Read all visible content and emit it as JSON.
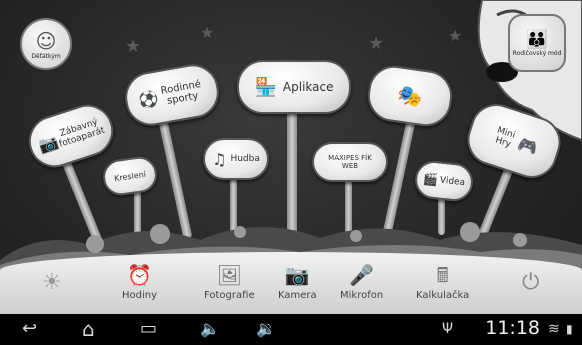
{
  "top": {
    "child_profile_label": "Děťátkým",
    "parent_mode_label": "Rodičovský mód"
  },
  "signs": {
    "fun_camera": "Zábavný fotoaparát",
    "family_sports": "Rodinné sporty",
    "apps": "Aplikace",
    "drawing": "Kreslení",
    "music": "Hudba",
    "web": "MAXIPES FÍK WEB",
    "video": "Videa",
    "mini_games": "Mini Hry"
  },
  "dock": {
    "hodiny": "Hodiny",
    "fotografie": "Fotografie",
    "kamera": "Kamera",
    "mikrofon": "Mikrofon",
    "kalkulacka": "Kalkulačka"
  },
  "status": {
    "time": "11:18"
  },
  "colors": {
    "background": "#262626",
    "sign": "#eeeeee",
    "dock": "#e6e6e6"
  }
}
